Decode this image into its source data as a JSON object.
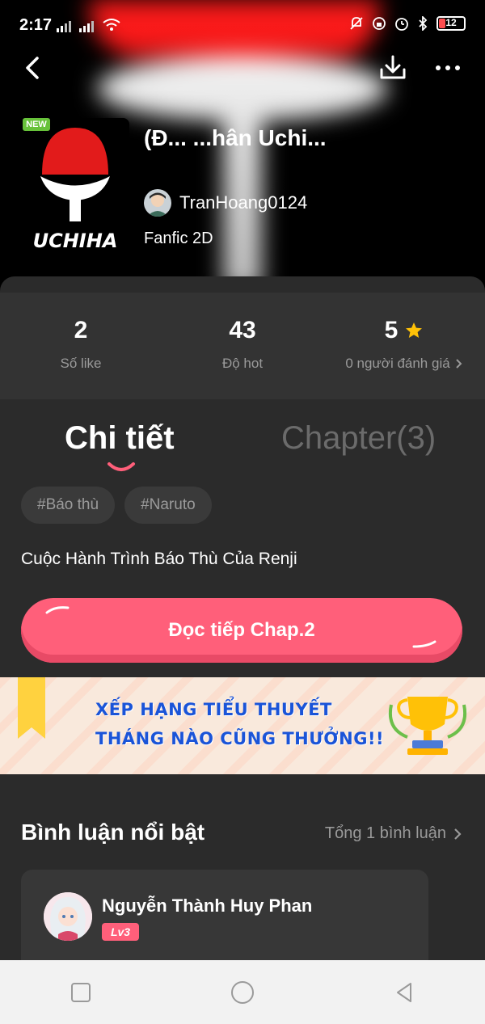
{
  "status_bar": {
    "time": "2:17",
    "battery_level": "12"
  },
  "story": {
    "badge_new": "NEW",
    "title": "(Đ... ...hân Uchi...",
    "author": "TranHoang0124",
    "category": "Fanfic 2D",
    "cover_text": "UCHIHA"
  },
  "stats": [
    {
      "value": "2",
      "label": "Số like"
    },
    {
      "value": "43",
      "label": "Độ hot"
    },
    {
      "value": "5",
      "label": "0 người đánh giá"
    }
  ],
  "tabs": {
    "details": "Chi tiết",
    "chapters": "Chapter(3)"
  },
  "tags": [
    "#Báo thù",
    "#Naruto"
  ],
  "description": "Cuộc Hành Trình Báo Thù Của Renji",
  "read_button": "Đọc tiếp Chap.2",
  "banner": {
    "line1": "XẾP HẠNG TIỂU THUYẾT",
    "line2": "THÁNG NÀO CŨNG THƯỞNG!!"
  },
  "comments": {
    "title": "Bình luận nổi bật",
    "total": "Tổng 1 bình luận",
    "items": [
      {
        "name": "Nguyễn Thành Huy Phan",
        "level": "Lv3"
      }
    ]
  },
  "colors": {
    "accent": "#ff5f7a",
    "background": "#2b2b2b",
    "stats_bg": "#333333",
    "banner_text": "#1a54d8",
    "new_badge": "#67c23a",
    "star": "#ffc107"
  },
  "icons": [
    "back-arrow-icon",
    "download-icon",
    "more-icon",
    "star-icon",
    "chevron-right-icon",
    "home-square-icon",
    "home-circle-icon",
    "back-triangle-icon"
  ]
}
